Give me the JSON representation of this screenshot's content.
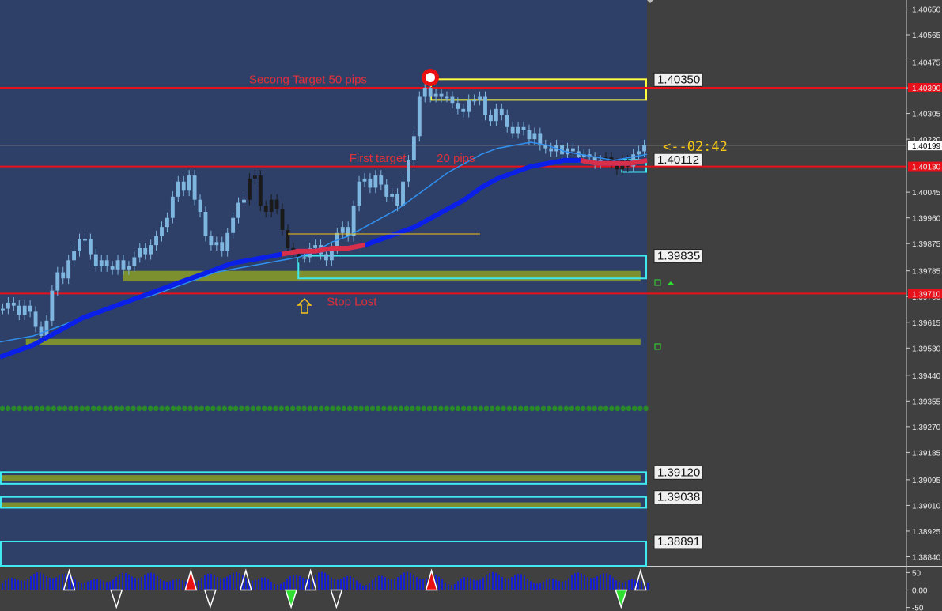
{
  "chart_data": {
    "type": "candlestick",
    "price_axis": {
      "ylim": [
        1.3881,
        1.4068
      ],
      "ticks": [
        "1.40650",
        "1.40565",
        "1.40475",
        "1.40390",
        "1.40305",
        "1.40220",
        "1.40045",
        "1.39960",
        "1.39875",
        "1.39785",
        "1.39700",
        "1.39615",
        "1.39530",
        "1.39440",
        "1.39355",
        "1.39270",
        "1.39185",
        "1.39095",
        "1.39010",
        "1.38925",
        "1.38840"
      ],
      "current_price": "1.40199",
      "line_labels": [
        {
          "price": 1.4039,
          "text": "1.40390"
        },
        {
          "price": 1.4013,
          "text": "1.40130"
        },
        {
          "price": 1.3971,
          "text": "1.39710"
        }
      ]
    },
    "indicator_axis": {
      "ticks": [
        "50",
        "0.00",
        "-50"
      ],
      "ylim": [
        -60,
        60
      ]
    },
    "horizontal_lines": [
      {
        "price": 1.4039,
        "color": "#e8101a"
      },
      {
        "price": 1.4013,
        "color": "#e8101a"
      },
      {
        "price": 1.3971,
        "color": "#e8101a"
      },
      {
        "price": 1.402,
        "color": "#a0a0a0"
      }
    ],
    "zones": [
      {
        "label": "1.40350",
        "top": 1.40418,
        "bottom": 1.4035,
        "x0": 0.665,
        "x1": 1.0,
        "color": "#ffff40"
      },
      {
        "label": "1.40112",
        "top": 1.40152,
        "bottom": 1.40112,
        "x0": 0.96,
        "x1": 1.0,
        "color": "#40e8f0"
      },
      {
        "label": "1.39835",
        "top": 1.39835,
        "bottom": 1.3976,
        "x0": 0.46,
        "x1": 1.0,
        "color": "#40e8f0"
      },
      {
        "label": "1.39120",
        "top": 1.3912,
        "bottom": 1.39082,
        "x0": 0.0,
        "x1": 1.0,
        "color": "#40e8f0"
      },
      {
        "label": "1.39038",
        "top": 1.39038,
        "bottom": 1.39002,
        "x0": 0.0,
        "x1": 1.0,
        "color": "#40e8f0"
      },
      {
        "label": "1.38891",
        "top": 1.38891,
        "bottom": 1.3881,
        "x0": 0.0,
        "x1": 1.0,
        "color": "#40e8f0"
      }
    ],
    "bands": [
      {
        "top": 1.39785,
        "bottom": 1.3975,
        "x0": 0.19,
        "x1": 0.99
      },
      {
        "top": 1.3956,
        "bottom": 1.3954,
        "x0": 0.04,
        "x1": 0.99
      },
      {
        "top": 1.3911,
        "bottom": 1.3909,
        "x0": 0.0,
        "x1": 0.99
      },
      {
        "top": 1.3902,
        "bottom": 1.39005,
        "x0": 0.0,
        "x1": 0.99
      }
    ],
    "dotted_line_price": 1.3933,
    "annotations": [
      {
        "text": "Secong Target   50 pips",
        "price": 1.40405,
        "xfrac": 0.385
      },
      {
        "text": "First target",
        "price": 1.40145,
        "xfrac": 0.54
      },
      {
        "text": "20 pips",
        "price": 1.40145,
        "xfrac": 0.675
      },
      {
        "text": "Stop Lost",
        "price": 1.3967,
        "xfrac": 0.505
      }
    ],
    "timer_text": "<--02:42",
    "closes": [
      1.3966,
      1.3968,
      1.3967,
      1.3964,
      1.3967,
      1.3965,
      1.396,
      1.3957,
      1.3962,
      1.3972,
      1.3978,
      1.3976,
      1.3982,
      1.3985,
      1.3989,
      1.3989,
      1.3984,
      1.398,
      1.3982,
      1.398,
      1.3979,
      1.3982,
      1.3979,
      1.398,
      1.3983,
      1.3986,
      1.3984,
      1.3987,
      1.399,
      1.3993,
      1.3996,
      1.4003,
      1.4008,
      1.4005,
      1.401,
      1.4002,
      1.3998,
      1.399,
      1.3987,
      1.3988,
      1.3985,
      1.3991,
      1.3996,
      1.4001,
      1.4002,
      1.4009,
      1.401,
      1.4,
      1.3998,
      1.4002,
      1.3999,
      1.3992,
      1.3986,
      1.3984,
      1.3983,
      1.3983,
      1.3986,
      1.3987,
      1.3984,
      1.3982,
      1.3986,
      1.3991,
      1.3993,
      1.399,
      1.4,
      1.4008,
      1.4009,
      1.4006,
      1.401,
      1.4007,
      1.4003,
      1.4004,
      1.4,
      1.4008,
      1.4015,
      1.4023,
      1.4036,
      1.4039,
      1.4036,
      1.4037,
      1.4036,
      1.4036,
      1.4034,
      1.4032,
      1.4031,
      1.4035,
      1.4035,
      1.4036,
      1.403,
      1.4028,
      1.4032,
      1.403,
      1.4026,
      1.4024,
      1.4026,
      1.4025,
      1.4022,
      1.4024,
      1.402,
      1.4019,
      1.4018,
      1.402,
      1.4017,
      1.4019,
      1.4018,
      1.4016,
      1.4017,
      1.4016,
      1.4014,
      1.4015,
      1.4016,
      1.4014,
      1.4012,
      1.4015,
      1.4013,
      1.4017,
      1.4018,
      1.402
    ],
    "ma_fast": [
      1.3955,
      1.3956,
      1.3957,
      1.3959,
      1.3961,
      1.3963,
      1.3965,
      1.3967,
      1.3969,
      1.397,
      1.3972,
      1.3974,
      1.3976,
      1.3978,
      1.3979,
      1.398,
      1.3981,
      1.3982,
      1.3983,
      1.3985,
      1.3988,
      1.399,
      1.3993,
      1.3996,
      1.3999,
      1.4003,
      1.4007,
      1.4011,
      1.4014,
      1.4017,
      1.4019,
      1.402,
      1.4021,
      1.402,
      1.4018,
      1.4017,
      1.4016,
      1.4015,
      1.4016,
      1.4017
    ],
    "ma_slow": [
      1.395,
      1.3952,
      1.3954,
      1.3957,
      1.396,
      1.3963,
      1.3965,
      1.3967,
      1.3969,
      1.3971,
      1.3973,
      1.3975,
      1.3977,
      1.3979,
      1.3981,
      1.3982,
      1.3983,
      1.3984,
      1.3985,
      1.3985,
      1.3986,
      1.3986,
      1.3987,
      1.3989,
      1.3991,
      1.3993,
      1.3996,
      1.3999,
      1.4002,
      1.4006,
      1.4009,
      1.4011,
      1.4013,
      1.4014,
      1.4015,
      1.4015,
      1.4014,
      1.4014,
      1.4014,
      1.4015
    ],
    "signal_markers": [
      {
        "xfrac": 0.107,
        "dir": "up",
        "color": "#ffffff"
      },
      {
        "xfrac": 0.18,
        "dir": "down",
        "color": "#ffffff"
      },
      {
        "xfrac": 0.295,
        "dir": "up",
        "color": "#e81010"
      },
      {
        "xfrac": 0.325,
        "dir": "down",
        "color": "#ffffff"
      },
      {
        "xfrac": 0.38,
        "dir": "up",
        "color": "#ffffff"
      },
      {
        "xfrac": 0.45,
        "dir": "down",
        "color": "#30e030"
      },
      {
        "xfrac": 0.48,
        "dir": "up",
        "color": "#ffffff"
      },
      {
        "xfrac": 0.52,
        "dir": "down",
        "color": "#ffffff"
      },
      {
        "xfrac": 0.667,
        "dir": "up",
        "color": "#e81010"
      },
      {
        "xfrac": 0.96,
        "dir": "down",
        "color": "#30e030"
      },
      {
        "xfrac": 0.99,
        "dir": "up",
        "color": "#ffffff"
      }
    ],
    "colors": {
      "chart_bg": "#2e4068",
      "right_bg": "#404040",
      "candle": "#7fb6e0",
      "candle_dark": "#1a1a1a",
      "ma_main": "#0a20e8",
      "ma_highlight": "#d8304a",
      "ma_signal": "#3090f0",
      "band": "#7c9030",
      "dots": "#2a8a2a"
    }
  }
}
